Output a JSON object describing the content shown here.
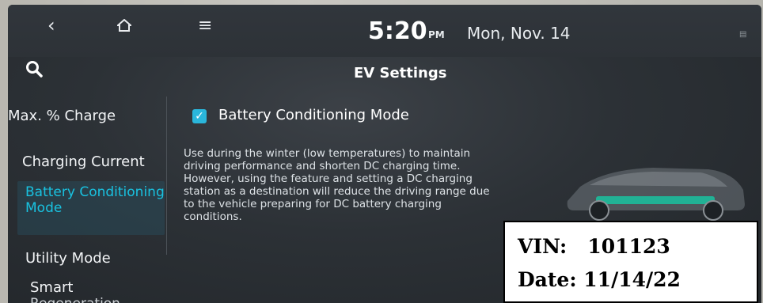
{
  "topbar": {
    "time": "5:20",
    "ampm": "PM",
    "date": "Mon, Nov. 14",
    "icons": [
      "back-icon",
      "home-icon",
      "menu-icon",
      "search-icon",
      "status-icon"
    ]
  },
  "page": {
    "title": "EV Settings"
  },
  "sidebar": {
    "items": [
      {
        "label": "Max. % Charge"
      },
      {
        "label": "Charging Current"
      },
      {
        "label": "Battery Conditioning Mode"
      },
      {
        "label": "Utility Mode"
      },
      {
        "label": "Smart"
      },
      {
        "label": "Regeneration"
      }
    ],
    "selected": "Battery Conditioning Mode"
  },
  "option": {
    "label": "Battery Conditioning Mode",
    "checked": true,
    "description": "Use during the winter (low temperatures) to maintain driving performance and shorten DC charging time. However, using the feature and setting a DC charging station as a destination will reduce the driving range due to the vehicle preparing for DC battery charging conditions."
  },
  "overlay": {
    "vin_label": "VIN:",
    "vin_value": "101123",
    "date_label": "Date:",
    "date_value": "11/14/22"
  },
  "colors": {
    "accent": "#19c2e0",
    "checkbox": "#2ab6db",
    "screen_bg": "#2c3136"
  }
}
